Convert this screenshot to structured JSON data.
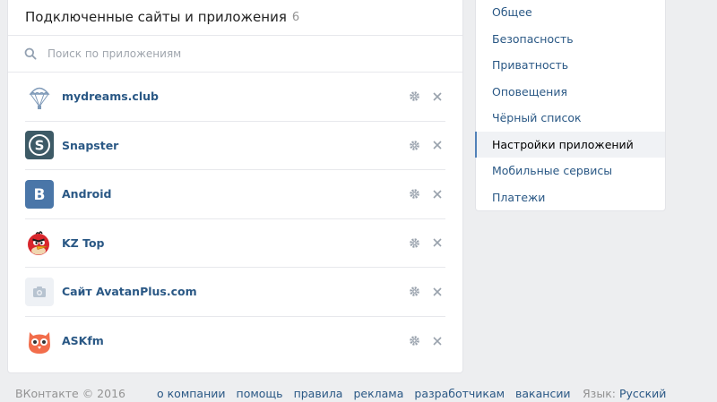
{
  "header": {
    "title": "Подключенные сайты и приложения",
    "count": "6"
  },
  "search": {
    "placeholder": "Поиск по приложениям"
  },
  "apps": [
    {
      "name": "mydreams.club",
      "icon": "parachute-icon"
    },
    {
      "name": "Snapster",
      "icon": "snapster-logo-icon"
    },
    {
      "name": "Android",
      "icon": "vk-logo-icon"
    },
    {
      "name": "KZ Top",
      "icon": "angry-bird-icon"
    },
    {
      "name": "Сайт AvatanPlus.com",
      "icon": "camera-placeholder-icon"
    },
    {
      "name": "ASKfm",
      "icon": "owl-icon"
    }
  ],
  "menu": {
    "items": [
      {
        "label": "Общее"
      },
      {
        "label": "Безопасность"
      },
      {
        "label": "Приватность"
      },
      {
        "label": "Оповещения"
      },
      {
        "label": "Чёрный список"
      },
      {
        "label": "Настройки приложений",
        "active": true
      },
      {
        "label": "Мобильные сервисы"
      },
      {
        "label": "Платежи"
      }
    ]
  },
  "footer": {
    "copyright": "ВКонтакте © 2016",
    "links": [
      "о компании",
      "помощь",
      "правила",
      "реклама",
      "разработчикам",
      "вакансии"
    ],
    "language_label": "Язык:",
    "language_value": "Русский"
  },
  "colors": {
    "link": "#2a5885",
    "accent": "#5181b8",
    "snapster": "#3d5a66",
    "vk": "#4a76a8",
    "askfm": "#f26d4b",
    "bird": "#d8262c"
  }
}
